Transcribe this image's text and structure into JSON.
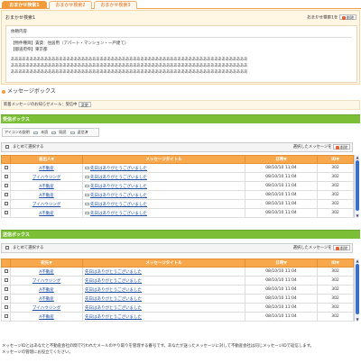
{
  "tabs": [
    "おまかせ検索1",
    "おまかせ検索2",
    "おまかせ検索3"
  ],
  "sheet": {
    "title": "おまかせ検索1",
    "right_label": "おまかせ検索1を",
    "delete_label": "削除",
    "inner_label": "依頼内容",
    "line1": "【物件種目】賃貸：住居用（アパート・マンション・一戸建て）",
    "line2": "【都道府県】東京都",
    "body_line": "ああああああああああああああああああああああああああああああああああああああああああああああああああああああああああああああああ"
  },
  "message_section": {
    "title": "メッセージボックス",
    "notify_text": "新着メッセージのお知らせメール：受信中",
    "change_label": "変更"
  },
  "inbox": {
    "title": "受信ボックス",
    "legend": [
      "アイコンの説明",
      "未読",
      "既読",
      "返信済"
    ],
    "bulk_select": "まとめて選択する",
    "bulk_delete_prefix": "選択したメッセージを",
    "delete_label": "削除",
    "columns": [
      "差出人▼",
      "メッセージタイトル",
      "日時▼",
      "ID▼"
    ],
    "rows": [
      {
        "sender": "A不動産",
        "title": "先日はありがとうございました",
        "date": "08/10/10 11:04",
        "id": "302"
      },
      {
        "sender": "ブイハウジング",
        "title": "先日はありがとうございました",
        "date": "08/10/10 11:04",
        "id": "302"
      },
      {
        "sender": "A不動産",
        "title": "先日はありがとうございました",
        "date": "08/10/10 11:04",
        "id": "302"
      },
      {
        "sender": "A不動産",
        "title": "先日はありがとうございました",
        "date": "08/10/10 11:04",
        "id": "302"
      },
      {
        "sender": "ブイハウジング",
        "title": "先日はありがとうございました",
        "date": "08/10/10 11:04",
        "id": "302"
      },
      {
        "sender": "A不動産",
        "title": "先日はありがとうございました",
        "date": "08/10/10 11:04",
        "id": "302"
      }
    ]
  },
  "outbox": {
    "title": "送信ボックス",
    "bulk_select": "まとめて選択する",
    "bulk_delete_prefix": "選択したメッセージを",
    "delete_label": "削除",
    "columns": [
      "宛先▼",
      "メッセージタイトル",
      "日時▼",
      "ID▼"
    ],
    "rows": [
      {
        "sender": "A不動産",
        "title": "先日はありがとうございました",
        "date": "08/10/10 11:04",
        "id": "302"
      },
      {
        "sender": "ブイハウジング",
        "title": "先日はありがとうございました",
        "date": "08/10/10 11:04",
        "id": "302"
      },
      {
        "sender": "A不動産",
        "title": "先日はありがとうございました",
        "date": "08/10/10 11:04",
        "id": "302"
      },
      {
        "sender": "A不動産",
        "title": "先日はありがとうございました",
        "date": "08/10/10 11:04",
        "id": "302"
      },
      {
        "sender": "ブイハウジング",
        "title": "先日はありがとうございました",
        "date": "08/10/10 11:04",
        "id": "302"
      },
      {
        "sender": "A不動産",
        "title": "先日はありがとうございました",
        "date": "08/10/10 11:04",
        "id": "302"
      }
    ]
  },
  "footer": {
    "line1": "メッセージIDとはあなたと不動産会社の間で行われたメールのやり取りを管理する番号です。あなたが送ったメッセージに対して不動産会社は同じメッセージIDで返信します。",
    "line2": "メッセージの管理にお役立てください。"
  },
  "colors": {
    "accent": "#f39a3b",
    "box_header": "#7cbf37",
    "table_header": "#f8a84c",
    "link": "#1d4fa8"
  }
}
